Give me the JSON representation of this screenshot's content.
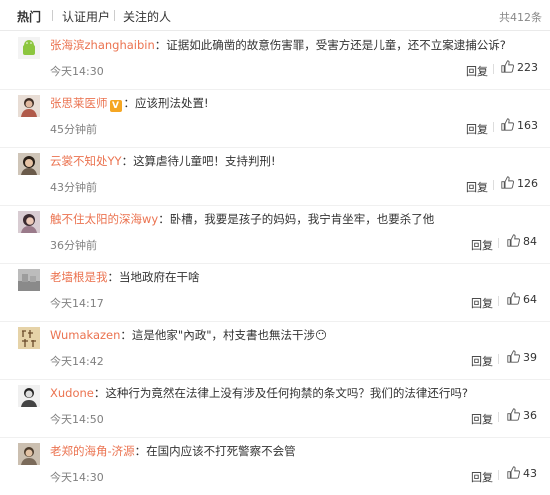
{
  "tabs": [
    {
      "label": "热门",
      "active": true
    },
    {
      "label": "认证用户",
      "active": false
    },
    {
      "label": "关注的人",
      "active": false
    }
  ],
  "total_label": "共412条",
  "reply_label": "回复",
  "comments": [
    {
      "username": "张海滨zhanghaibin",
      "verified": false,
      "text": "证据如此确凿的故意伤害罪，受害方还是儿童，还不立案逮捕公诉?",
      "time": "今天14:30",
      "likes": "223",
      "avatar_color": "#8cc63f"
    },
    {
      "username": "张思莱医师",
      "verified": true,
      "verified_mark": "V",
      "text": "应该刑法处置!",
      "time": "45分钟前",
      "likes": "163",
      "avatar_color": "#b05a4a"
    },
    {
      "username": "云裳不知处YY",
      "verified": false,
      "text": "这算虐待儿童吧！支持判刑!",
      "time": "43分钟前",
      "likes": "126",
      "avatar_color": "#6a5a4a"
    },
    {
      "username": "触不住太阳的深海wy",
      "verified": false,
      "text": "卧槽，我要是孩子的妈妈，我宁肯坐牢，也要杀了他",
      "time": "36分钟前",
      "likes": "84",
      "avatar_color": "#9a7a8a"
    },
    {
      "username": "老墙根是我",
      "verified": false,
      "text": "当地政府在干啥",
      "time": "今天14:17",
      "likes": "64",
      "avatar_color": "#8a8a8a"
    },
    {
      "username": "Wumakazen",
      "verified": false,
      "text": "這是他家\"內政\"，村支書也無法干涉😶",
      "time": "今天14:42",
      "likes": "39",
      "avatar_color": "#c9a86a"
    },
    {
      "username": "Xudone",
      "verified": false,
      "text": "这种行为竟然在法律上没有涉及任何拘禁的条文吗？我们的法律还行吗?",
      "time": "今天14:50",
      "likes": "36",
      "avatar_color": "#444444"
    },
    {
      "username": "老郑的海角-济源",
      "verified": false,
      "text": "在国内应该不打死警察不会管",
      "time": "今天14:30",
      "likes": "43",
      "avatar_color": "#7a6a5a"
    }
  ]
}
